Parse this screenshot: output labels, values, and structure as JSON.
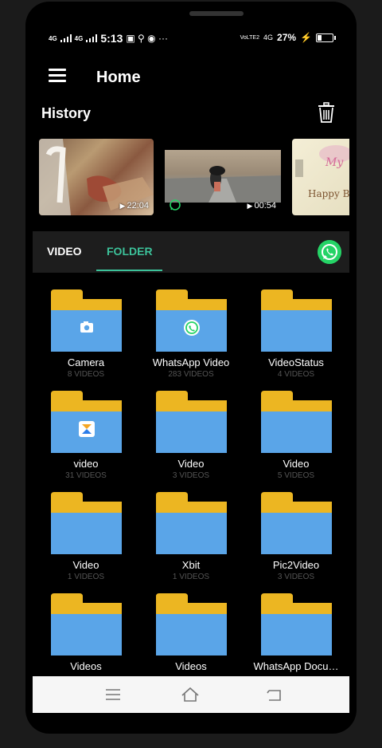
{
  "status_bar": {
    "time": "5:13",
    "battery": "27%",
    "network_left": "4G",
    "network_right": "4G",
    "volte_label": "VoLTE2"
  },
  "app_bar": {
    "title": "Home",
    "menu_icon": "hamburger-icon"
  },
  "history": {
    "label": "History",
    "delete_icon": "trash-icon",
    "items": [
      {
        "duration": "22:04"
      },
      {
        "duration": "00:54",
        "badge": "whatsapp-icon"
      },
      {
        "text_line1": "My",
        "text_line2": "Happy B"
      }
    ]
  },
  "tabs": {
    "items": [
      "VIDEO",
      "FOLDER"
    ],
    "active": "FOLDER",
    "action_icon": "whatsapp-icon"
  },
  "folders": [
    {
      "name": "Camera",
      "count": "8 VIDEOS",
      "badge": "camera-icon"
    },
    {
      "name": "WhatsApp Video",
      "count": "283 VIDEOS",
      "badge": "whatsapp-icon"
    },
    {
      "name": "VideoStatus",
      "count": "4 VIDEOS",
      "badge": ""
    },
    {
      "name": "video",
      "count": "31 VIDEOS",
      "badge": "xender-icon"
    },
    {
      "name": "Video",
      "count": "3 VIDEOS",
      "badge": ""
    },
    {
      "name": "Video",
      "count": "5 VIDEOS",
      "badge": ""
    },
    {
      "name": "Video",
      "count": "1 VIDEOS",
      "badge": ""
    },
    {
      "name": "Xbit",
      "count": "1 VIDEOS",
      "badge": ""
    },
    {
      "name": "Pic2Video",
      "count": "3 VIDEOS",
      "badge": ""
    },
    {
      "name": "Videos",
      "count": "",
      "badge": ""
    },
    {
      "name": "Videos",
      "count": "",
      "badge": ""
    },
    {
      "name": "WhatsApp Docu…",
      "count": "",
      "badge": ""
    }
  ],
  "colors": {
    "accent": "#3cc29a",
    "folder_tab": "#ecb622",
    "folder_body": "#5aa5e8",
    "whatsapp": "#25d366"
  },
  "nav_bar": {
    "icons": [
      "menu-icon",
      "home-icon",
      "back-icon"
    ]
  }
}
